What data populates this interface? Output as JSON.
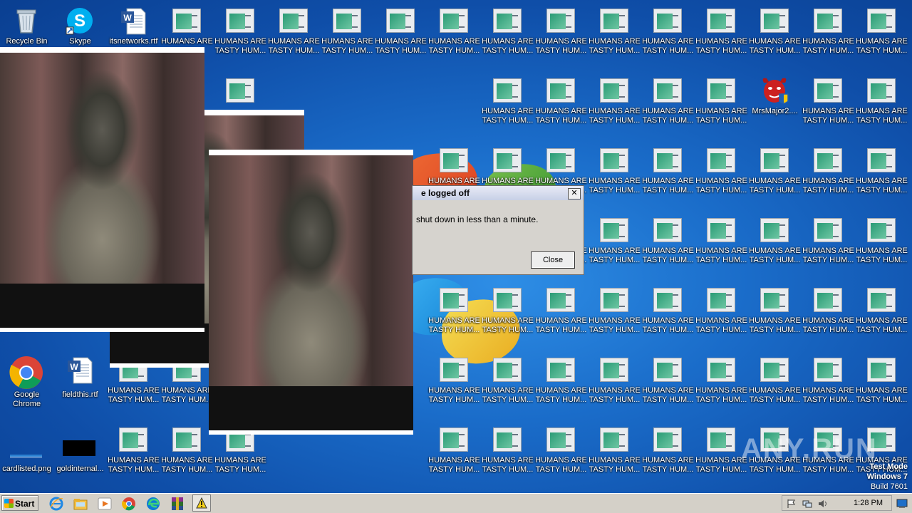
{
  "desktop": {
    "fixed_icons": {
      "recycle_bin": "Recycle Bin",
      "skype": "Skype",
      "itsnetworks": "itsnetworks.rtf",
      "google_chrome": "Google\nChrome",
      "fieldthis": "fieldthis.rtf",
      "cardlisted": "cardlisted.png",
      "goldinternal": "goldinternal...",
      "mrsmajor": "MrsMajor2...."
    },
    "repeated_label": "HUMANS ARE\nTASTY HUM...",
    "partial_label": "HUMANS ARE"
  },
  "dialog": {
    "title": "e logged off",
    "message": "shut down in less than a minute.",
    "close_label": "Close",
    "x_label": "✕"
  },
  "watermark": "ANY.RUN",
  "os_label": {
    "mode": "Test Mode",
    "product": "Windows 7",
    "build": "Build 7601"
  },
  "taskbar": {
    "start_label": "Start",
    "clock": "1:28 PM"
  },
  "colors": {
    "desktop_bg": "#1a6cc9",
    "taskbar_bg": "#d4d0c8"
  },
  "icons": [
    "recycle-bin-icon",
    "skype-icon",
    "word-document-icon",
    "chrome-icon",
    "devil-shield-icon",
    "internet-explorer-icon",
    "explorer-icon",
    "media-player-icon",
    "edge-icon",
    "winrar-icon",
    "warning-icon",
    "flag-icon",
    "network-icon",
    "volume-icon",
    "show-desktop-icon"
  ]
}
